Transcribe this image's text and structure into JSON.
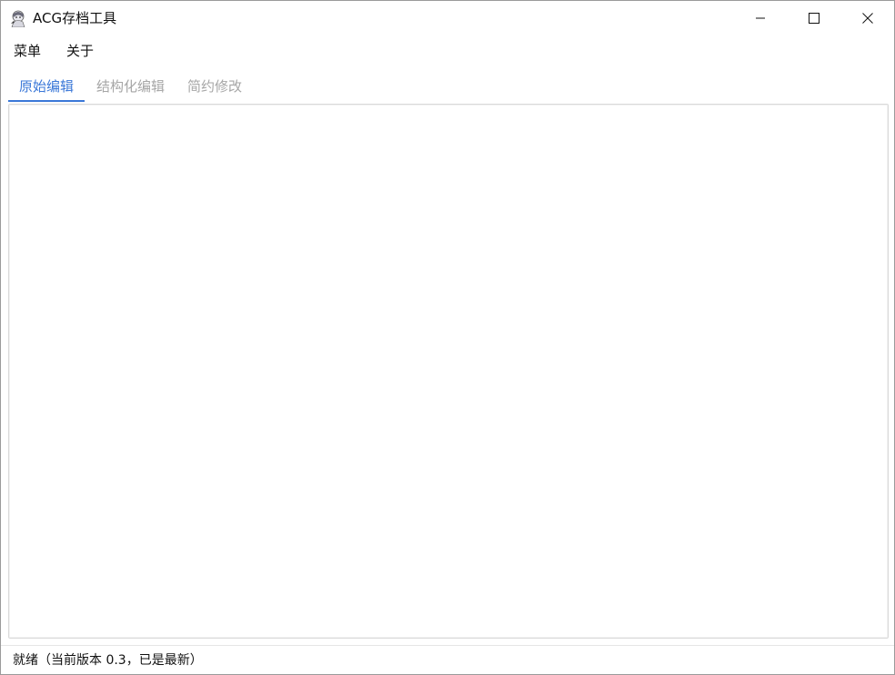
{
  "window": {
    "title": "ACG存档工具",
    "app_icon": "anime-character-icon",
    "controls": {
      "minimize_icon": "minimize-icon",
      "maximize_icon": "maximize-icon",
      "close_icon": "close-icon"
    }
  },
  "menubar": {
    "items": [
      {
        "label": "菜单"
      },
      {
        "label": "关于"
      }
    ]
  },
  "tabs": {
    "items": [
      {
        "label": "原始编辑",
        "active": true
      },
      {
        "label": "结构化编辑",
        "active": false
      },
      {
        "label": "简约修改",
        "active": false
      }
    ]
  },
  "editor": {
    "value": ""
  },
  "statusbar": {
    "text": "就绪（当前版本 0.3，已是最新）"
  },
  "colors": {
    "accent": "#3b78d8",
    "inactive_tab": "#a6a6a6",
    "border": "#d9d9d9"
  }
}
